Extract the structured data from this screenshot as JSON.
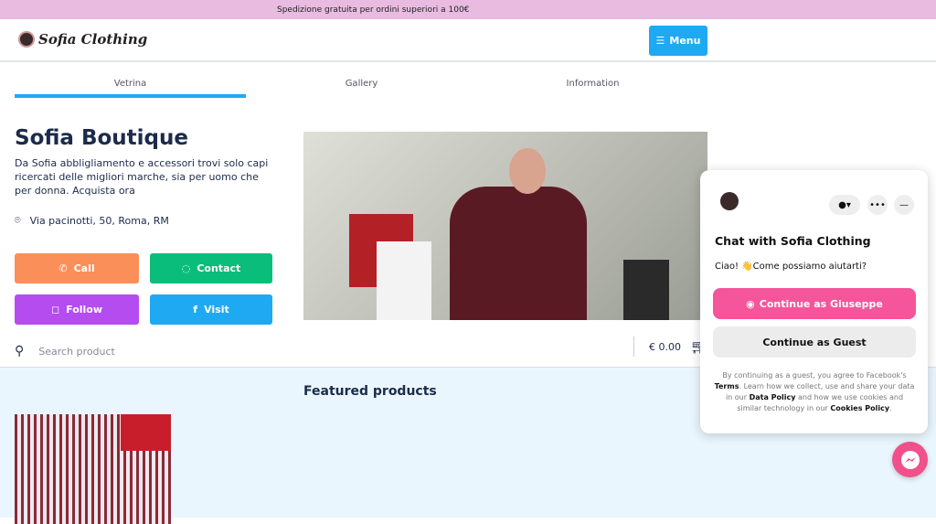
{
  "topbar": {
    "text": "Spedizione gratuita per ordini superiori a 100€"
  },
  "header": {
    "logo": "Sofia Clothing",
    "menu_label": "Menu"
  },
  "tabs": [
    {
      "label": "Vetrina",
      "active": true
    },
    {
      "label": "Gallery"
    },
    {
      "label": "Information"
    }
  ],
  "shop": {
    "name": "Sofia Boutique",
    "description": "Da Sofia abbligliamento e accessori trovi solo capi ricercati delle migliori marche, sia per uomo che per donna. Acquista ora",
    "address": "Via pacinotti, 50, Roma, RM"
  },
  "actions": {
    "call": "Call",
    "contact": "Contact",
    "follow": "Follow",
    "visit": "Visit"
  },
  "colors": {
    "call": "#fb8f5a",
    "contact": "#0bbd7a",
    "follow": "#b44cf0",
    "visit": "#1fa9f2",
    "accent": "#1fa9f2"
  },
  "search": {
    "placeholder": "Search product"
  },
  "cart": {
    "total": "€ 0.00"
  },
  "featured": {
    "title": "Featured products"
  },
  "chat": {
    "title": "Chat with Sofia Clothing",
    "greeting": "Ciao! 👋Come possiamo aiutarti?",
    "continue_as": "Continue as Giuseppe",
    "guest": "Continue as Guest",
    "legal": {
      "p1": "By continuing as a guest, you agree to Facebook's ",
      "terms": "Terms",
      "p2": ". Learn how we collect, use and share your data in our ",
      "data_policy": "Data Policy",
      "p3": " and how we use cookies and similar technology in our ",
      "cookies": "Cookies Policy",
      "p4": "."
    }
  }
}
